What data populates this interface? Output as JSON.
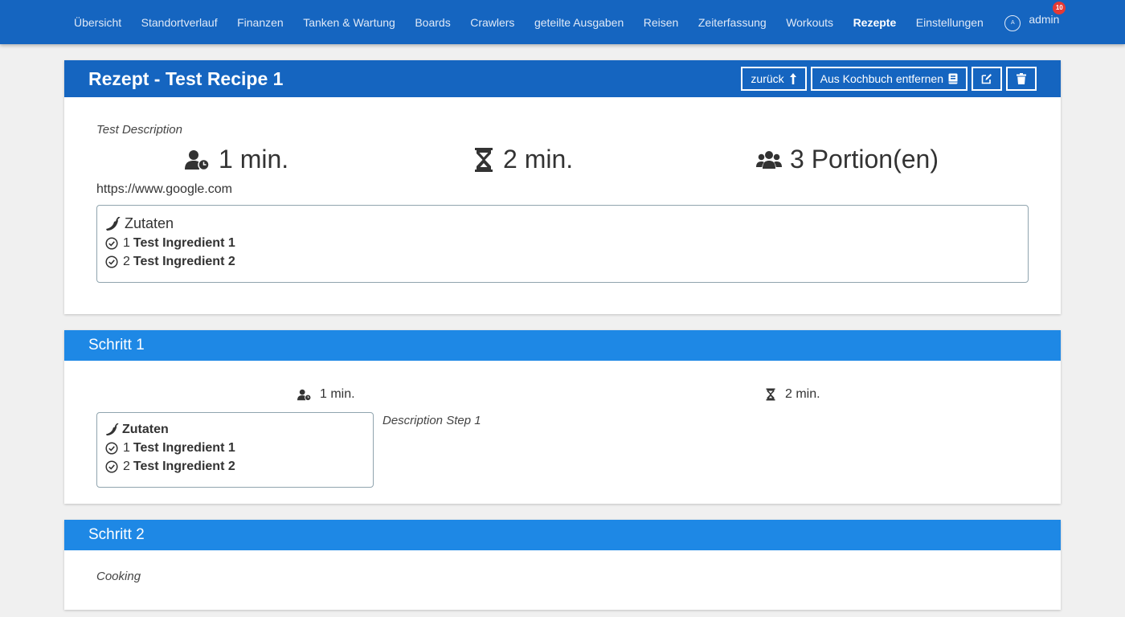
{
  "nav": {
    "items": [
      "Übersicht",
      "Standortverlauf",
      "Finanzen",
      "Tanken & Wartung",
      "Boards",
      "Crawlers",
      "geteilte Ausgaben",
      "Reisen",
      "Zeiterfassung",
      "Workouts",
      "Rezepte",
      "Einstellungen"
    ],
    "active": "Rezepte",
    "user": {
      "avatar_letter": "A",
      "name": "admin",
      "badge": "10"
    }
  },
  "recipe": {
    "title": "Rezept - Test Recipe 1",
    "buttons": {
      "back": "zurück",
      "remove": "Aus Kochbuch entfernen"
    },
    "description": "Test Description",
    "stats": {
      "prep_time": "1 min.",
      "cook_time": "2 min.",
      "portions": "3 Portion(en)"
    },
    "url": "https://www.google.com",
    "ingredients_title": "Zutaten",
    "ingredients": [
      {
        "qty": "1",
        "name": "Test Ingredient 1"
      },
      {
        "qty": "2",
        "name": "Test Ingredient 2"
      }
    ]
  },
  "steps": [
    {
      "title": "Schritt 1",
      "prep_time": "1 min.",
      "cook_time": "2 min.",
      "ingredients_title": "Zutaten",
      "ingredients": [
        {
          "qty": "1",
          "name": "Test Ingredient 1"
        },
        {
          "qty": "2",
          "name": "Test Ingredient 2"
        }
      ],
      "description": "Description Step 1"
    },
    {
      "title": "Schritt 2",
      "description": "Cooking"
    }
  ],
  "icons": {
    "prep": "user-clock-icon",
    "cook": "hourglass-icon",
    "portions": "users-icon",
    "ingredients": "pepper-icon",
    "check": "check-circle-icon",
    "back": "level-up-icon",
    "book": "book-icon",
    "edit": "edit-icon",
    "delete": "trash-icon"
  },
  "colors": {
    "navbar": "#1565c0",
    "step_header": "#1e88e5",
    "background": "#f0f0f0"
  }
}
